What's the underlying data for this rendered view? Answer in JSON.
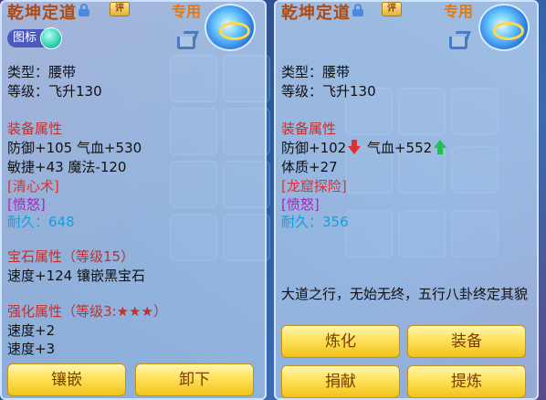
{
  "left": {
    "title": "乾坤定道",
    "badge": "评",
    "exclusive": "专用",
    "tag_label": "图标",
    "type_line": "类型：腰带",
    "level_line": "等级：飞升130",
    "equip_attr_heading": "装备属性",
    "attr_line1": "防御+105 气血+530",
    "attr_line2": "敏捷+43 魔法-120",
    "special1": "[清心术]",
    "special2": "[愤怒]",
    "durability": "耐久：648",
    "gem_heading": "宝石属性（等级15）",
    "gem_line": "速度+124 镶嵌黑宝石",
    "enhance_heading": "强化属性（等级3:★★★）",
    "enhance_line1": "速度+2",
    "enhance_line2": "速度+3",
    "btn_inlay": "镶嵌",
    "btn_unequip": "卸下"
  },
  "right": {
    "title": "乾坤定道",
    "badge": "评",
    "exclusive": "专用",
    "type_line": "类型：腰带",
    "level_line": "等级：飞升130",
    "equip_attr_heading": "装备属性",
    "attr_line1_a": "防御+102",
    "attr_line1_b": "气血+552",
    "attr_line2": "体质+27",
    "special1": "[龙窟探险]",
    "special2": "[愤怒]",
    "durability": "耐久：356",
    "description": "大道之行，无始无终，五行八卦终定其貌",
    "btn_refine": "炼化",
    "btn_equip": "装备",
    "btn_donate": "捐献",
    "btn_extract": "提炼"
  },
  "colors": {
    "section_red": "#c03030",
    "special_red": "#e03030",
    "special_purple": "#b020c0",
    "durability_cyan": "#10a0e0",
    "title_orange": "#b04a10",
    "button_gold": "#ffe25a"
  },
  "icons": [
    "lock-icon",
    "share-icon",
    "equipment-orb-icon",
    "toggle-icon",
    "arrow-down-icon",
    "arrow-up-icon"
  ]
}
